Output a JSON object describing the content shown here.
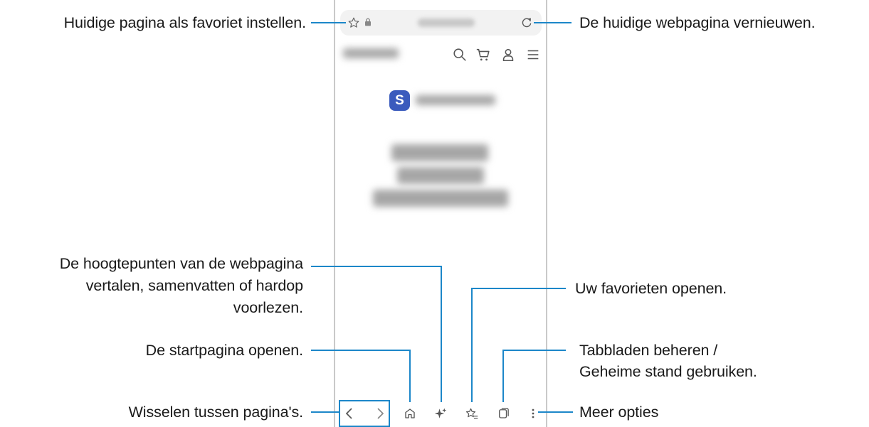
{
  "callouts": {
    "favorite": "Huidige pagina als favoriet instellen.",
    "refresh": "De huidige webpagina vernieuwen.",
    "highlights": [
      "De hoogtepunten van de webpagina",
      "vertalen, samenvatten of hardop",
      "voorlezen."
    ],
    "bookmarks": "Uw favorieten openen.",
    "home": "De startpagina openen.",
    "tabs": [
      "Tabbladen beheren /",
      "Geheime stand gebruiken."
    ],
    "switch_pages": "Wisselen tussen pagina's.",
    "more": "Meer opties"
  },
  "phone": {
    "logo_letter": "S"
  },
  "colors": {
    "leader": "#1c87c9",
    "phone_border": "#c9c9c9",
    "urlbar_bg": "#f2f2f2",
    "logo_bg": "#3b5bbd"
  },
  "icons": [
    "star-icon",
    "lock-icon",
    "refresh-icon",
    "search-icon",
    "cart-icon",
    "user-icon",
    "menu-icon",
    "back-icon",
    "forward-icon",
    "home-icon",
    "sparkle-icon",
    "bookmarks-icon",
    "tabs-icon",
    "more-icon"
  ]
}
